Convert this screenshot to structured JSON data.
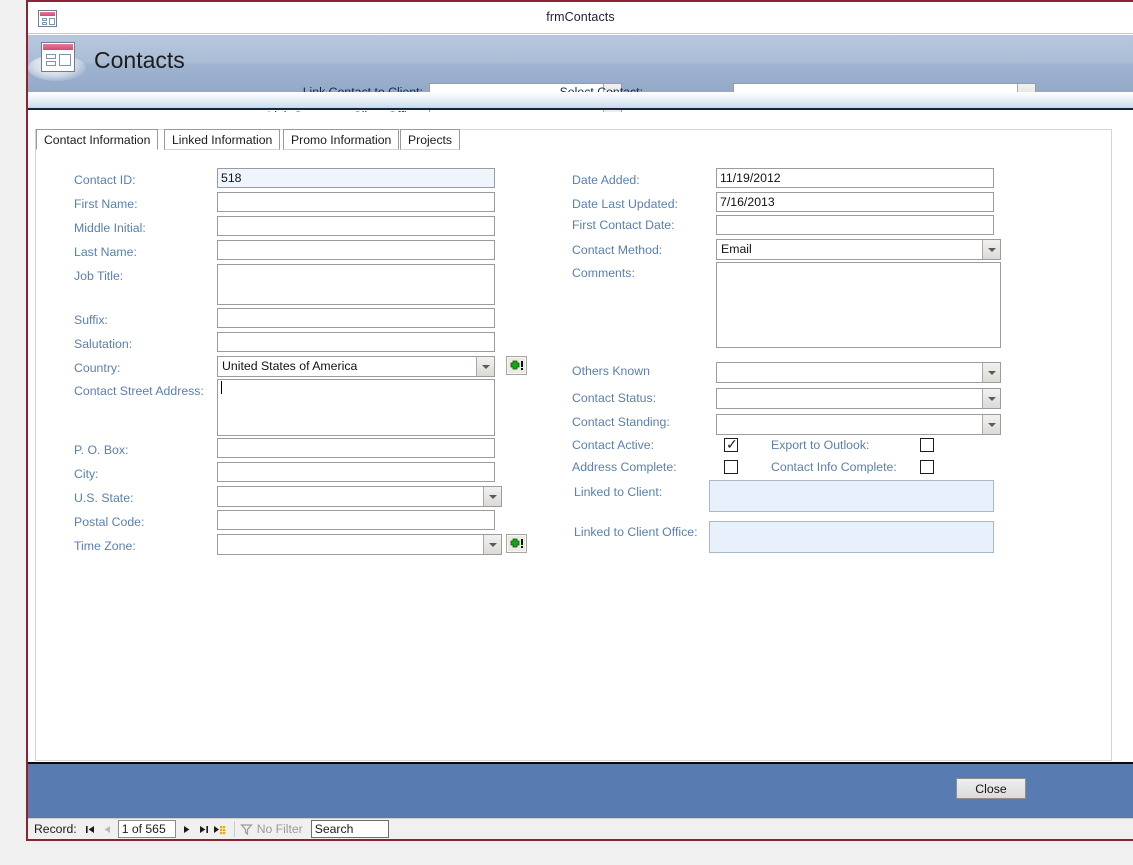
{
  "window": {
    "title": "frmContacts",
    "icon": "access-form-icon"
  },
  "header": {
    "title": "Contacts",
    "logo_icon": "access-form-icon",
    "fields": [
      {
        "label": "Link Contact to Client:",
        "value": "",
        "icon": "chevron-down-icon"
      },
      {
        "label": "Link Contact to Client Office:",
        "value": "",
        "icon": "chevron-down-icon"
      },
      {
        "label": "Select Contact:",
        "value": "",
        "icon": "chevron-down-icon"
      }
    ]
  },
  "tabs": [
    {
      "label": "Contact Information",
      "active": true
    },
    {
      "label": "Linked Information",
      "active": false
    },
    {
      "label": "Promo Information",
      "active": false
    },
    {
      "label": "Projects",
      "active": false
    }
  ],
  "left_column": {
    "contact_id": {
      "label": "Contact ID:",
      "value": "518"
    },
    "first_name": {
      "label": "First Name:",
      "value": ""
    },
    "middle_initial": {
      "label": "Middle Initial:",
      "value": ""
    },
    "last_name": {
      "label": "Last Name:",
      "value": ""
    },
    "job_title": {
      "label": "Job Title:",
      "value": ""
    },
    "suffix": {
      "label": "Suffix:",
      "value": ""
    },
    "salutation": {
      "label": "Salutation:",
      "value": ""
    },
    "country": {
      "label": "Country:",
      "value": "United States of America"
    },
    "country_add_button": {
      "icon": "add-green-plus-icon",
      "label": ""
    },
    "street_address": {
      "label": "Contact Street Address:",
      "value": ""
    },
    "po_box": {
      "label": "P. O. Box:",
      "value": ""
    },
    "city": {
      "label": "City:",
      "value": ""
    },
    "us_state": {
      "label": "U.S. State:",
      "value": ""
    },
    "postal_code": {
      "label": "Postal Code:",
      "value": ""
    },
    "time_zone": {
      "label": "Time Zone:",
      "value": ""
    },
    "timezone_add_button": {
      "icon": "add-green-plus-icon",
      "label": ""
    }
  },
  "right_column": {
    "date_added": {
      "label": "Date Added:",
      "value": "11/19/2012"
    },
    "date_last_updated": {
      "label": "Date Last Updated:",
      "value": "7/16/2013"
    },
    "first_contact_date": {
      "label": "First Contact Date:",
      "value": ""
    },
    "contact_method": {
      "label": "Contact Method:",
      "value": "Email"
    },
    "comments": {
      "label": "Comments:",
      "value": ""
    },
    "others_known": {
      "label": "Others Known",
      "value": ""
    },
    "contact_status": {
      "label": "Contact Status:",
      "value": ""
    },
    "contact_standing": {
      "label": "Contact Standing:",
      "value": ""
    },
    "contact_active": {
      "label": "Contact Active:",
      "checked": true
    },
    "export_to_outlook": {
      "label": "Export to Outlook:",
      "checked": false
    },
    "address_complete": {
      "label": "Address Complete:",
      "checked": false
    },
    "contact_info_complete": {
      "label": "Contact Info Complete:",
      "checked": false
    },
    "linked_to_client": {
      "label": "Linked to Client:",
      "value": ""
    },
    "linked_to_client_office": {
      "label": "Linked to Client Office:",
      "value": ""
    }
  },
  "footer": {
    "close_label": "Close"
  },
  "navigation": {
    "record_label": "Record:",
    "first_icon": "first-record-icon",
    "previous_icon": "previous-record-icon",
    "record_value": "1 of 565",
    "next_icon": "next-record-icon",
    "last_icon": "last-record-icon",
    "new_icon": "new-record-icon",
    "filter_icon": "filter-icon",
    "filter_label": "No Filter",
    "search_value": "Search"
  },
  "colors": {
    "header_blue": "#aabdd6",
    "footer_blue": "#587cb2",
    "window_border": "#8b2430",
    "label_blue": "#5a7fad",
    "readonly_field": "#eef5fd",
    "linked_field": "#e8f1fb"
  }
}
